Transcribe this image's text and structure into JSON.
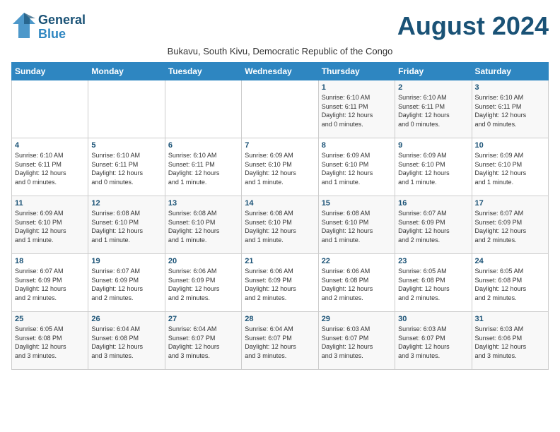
{
  "header": {
    "logo_general": "General",
    "logo_blue": "Blue",
    "month_title": "August 2024",
    "subtitle": "Bukavu, South Kivu, Democratic Republic of the Congo"
  },
  "days_of_week": [
    "Sunday",
    "Monday",
    "Tuesday",
    "Wednesday",
    "Thursday",
    "Friday",
    "Saturday"
  ],
  "weeks": [
    [
      {
        "day": "",
        "info": ""
      },
      {
        "day": "",
        "info": ""
      },
      {
        "day": "",
        "info": ""
      },
      {
        "day": "",
        "info": ""
      },
      {
        "day": "1",
        "info": "Sunrise: 6:10 AM\nSunset: 6:11 PM\nDaylight: 12 hours\nand 0 minutes."
      },
      {
        "day": "2",
        "info": "Sunrise: 6:10 AM\nSunset: 6:11 PM\nDaylight: 12 hours\nand 0 minutes."
      },
      {
        "day": "3",
        "info": "Sunrise: 6:10 AM\nSunset: 6:11 PM\nDaylight: 12 hours\nand 0 minutes."
      }
    ],
    [
      {
        "day": "4",
        "info": "Sunrise: 6:10 AM\nSunset: 6:11 PM\nDaylight: 12 hours\nand 0 minutes."
      },
      {
        "day": "5",
        "info": "Sunrise: 6:10 AM\nSunset: 6:11 PM\nDaylight: 12 hours\nand 0 minutes."
      },
      {
        "day": "6",
        "info": "Sunrise: 6:10 AM\nSunset: 6:11 PM\nDaylight: 12 hours\nand 1 minute."
      },
      {
        "day": "7",
        "info": "Sunrise: 6:09 AM\nSunset: 6:10 PM\nDaylight: 12 hours\nand 1 minute."
      },
      {
        "day": "8",
        "info": "Sunrise: 6:09 AM\nSunset: 6:10 PM\nDaylight: 12 hours\nand 1 minute."
      },
      {
        "day": "9",
        "info": "Sunrise: 6:09 AM\nSunset: 6:10 PM\nDaylight: 12 hours\nand 1 minute."
      },
      {
        "day": "10",
        "info": "Sunrise: 6:09 AM\nSunset: 6:10 PM\nDaylight: 12 hours\nand 1 minute."
      }
    ],
    [
      {
        "day": "11",
        "info": "Sunrise: 6:09 AM\nSunset: 6:10 PM\nDaylight: 12 hours\nand 1 minute."
      },
      {
        "day": "12",
        "info": "Sunrise: 6:08 AM\nSunset: 6:10 PM\nDaylight: 12 hours\nand 1 minute."
      },
      {
        "day": "13",
        "info": "Sunrise: 6:08 AM\nSunset: 6:10 PM\nDaylight: 12 hours\nand 1 minute."
      },
      {
        "day": "14",
        "info": "Sunrise: 6:08 AM\nSunset: 6:10 PM\nDaylight: 12 hours\nand 1 minute."
      },
      {
        "day": "15",
        "info": "Sunrise: 6:08 AM\nSunset: 6:10 PM\nDaylight: 12 hours\nand 1 minute."
      },
      {
        "day": "16",
        "info": "Sunrise: 6:07 AM\nSunset: 6:09 PM\nDaylight: 12 hours\nand 2 minutes."
      },
      {
        "day": "17",
        "info": "Sunrise: 6:07 AM\nSunset: 6:09 PM\nDaylight: 12 hours\nand 2 minutes."
      }
    ],
    [
      {
        "day": "18",
        "info": "Sunrise: 6:07 AM\nSunset: 6:09 PM\nDaylight: 12 hours\nand 2 minutes."
      },
      {
        "day": "19",
        "info": "Sunrise: 6:07 AM\nSunset: 6:09 PM\nDaylight: 12 hours\nand 2 minutes."
      },
      {
        "day": "20",
        "info": "Sunrise: 6:06 AM\nSunset: 6:09 PM\nDaylight: 12 hours\nand 2 minutes."
      },
      {
        "day": "21",
        "info": "Sunrise: 6:06 AM\nSunset: 6:09 PM\nDaylight: 12 hours\nand 2 minutes."
      },
      {
        "day": "22",
        "info": "Sunrise: 6:06 AM\nSunset: 6:08 PM\nDaylight: 12 hours\nand 2 minutes."
      },
      {
        "day": "23",
        "info": "Sunrise: 6:05 AM\nSunset: 6:08 PM\nDaylight: 12 hours\nand 2 minutes."
      },
      {
        "day": "24",
        "info": "Sunrise: 6:05 AM\nSunset: 6:08 PM\nDaylight: 12 hours\nand 2 minutes."
      }
    ],
    [
      {
        "day": "25",
        "info": "Sunrise: 6:05 AM\nSunset: 6:08 PM\nDaylight: 12 hours\nand 3 minutes."
      },
      {
        "day": "26",
        "info": "Sunrise: 6:04 AM\nSunset: 6:08 PM\nDaylight: 12 hours\nand 3 minutes."
      },
      {
        "day": "27",
        "info": "Sunrise: 6:04 AM\nSunset: 6:07 PM\nDaylight: 12 hours\nand 3 minutes."
      },
      {
        "day": "28",
        "info": "Sunrise: 6:04 AM\nSunset: 6:07 PM\nDaylight: 12 hours\nand 3 minutes."
      },
      {
        "day": "29",
        "info": "Sunrise: 6:03 AM\nSunset: 6:07 PM\nDaylight: 12 hours\nand 3 minutes."
      },
      {
        "day": "30",
        "info": "Sunrise: 6:03 AM\nSunset: 6:07 PM\nDaylight: 12 hours\nand 3 minutes."
      },
      {
        "day": "31",
        "info": "Sunrise: 6:03 AM\nSunset: 6:06 PM\nDaylight: 12 hours\nand 3 minutes."
      }
    ]
  ]
}
